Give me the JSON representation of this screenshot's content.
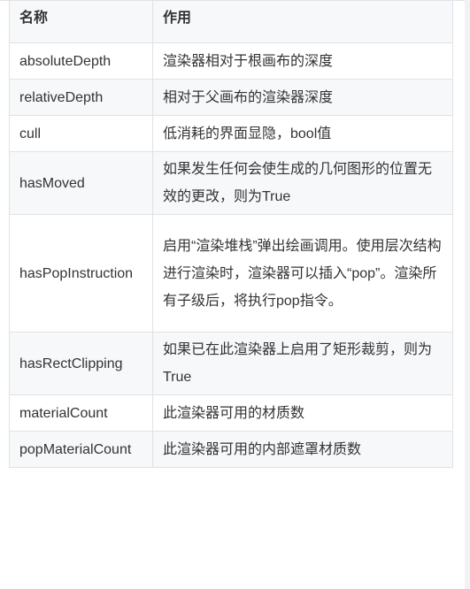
{
  "table": {
    "headers": {
      "name": "名称",
      "description": "作用"
    },
    "rows": [
      {
        "name": "absoluteDepth",
        "description": "渲染器相对于根画布的深度"
      },
      {
        "name": "relativeDepth",
        "description": "相对于父画布的渲染器深度"
      },
      {
        "name": "cull",
        "description": "低消耗的界面显隐，bool值"
      },
      {
        "name": "hasMoved",
        "description": "如果发生任何会使生成的几何图形的位置无效的更改，则为True"
      },
      {
        "name": "hasPopInstruction",
        "description": "启用“渲染堆栈”弹出绘画调用。使用层次结构进行渲染时，渲染器可以插入“pop”。渲染所有子级后，将执行pop指令。"
      },
      {
        "name": "hasRectClipping",
        "description": "如果已在此渲染器上启用了矩形裁剪，则为True"
      },
      {
        "name": "materialCount",
        "description": "此渲染器可用的材质数"
      },
      {
        "name": "popMaterialCount",
        "description": "此渲染器可用的内部遮罩材质数"
      }
    ]
  },
  "colors": {
    "header_bg": "#f6f8fa",
    "stripe_bg": "#f6f8fa",
    "border": "#dfe2e5",
    "text": "#333333"
  }
}
